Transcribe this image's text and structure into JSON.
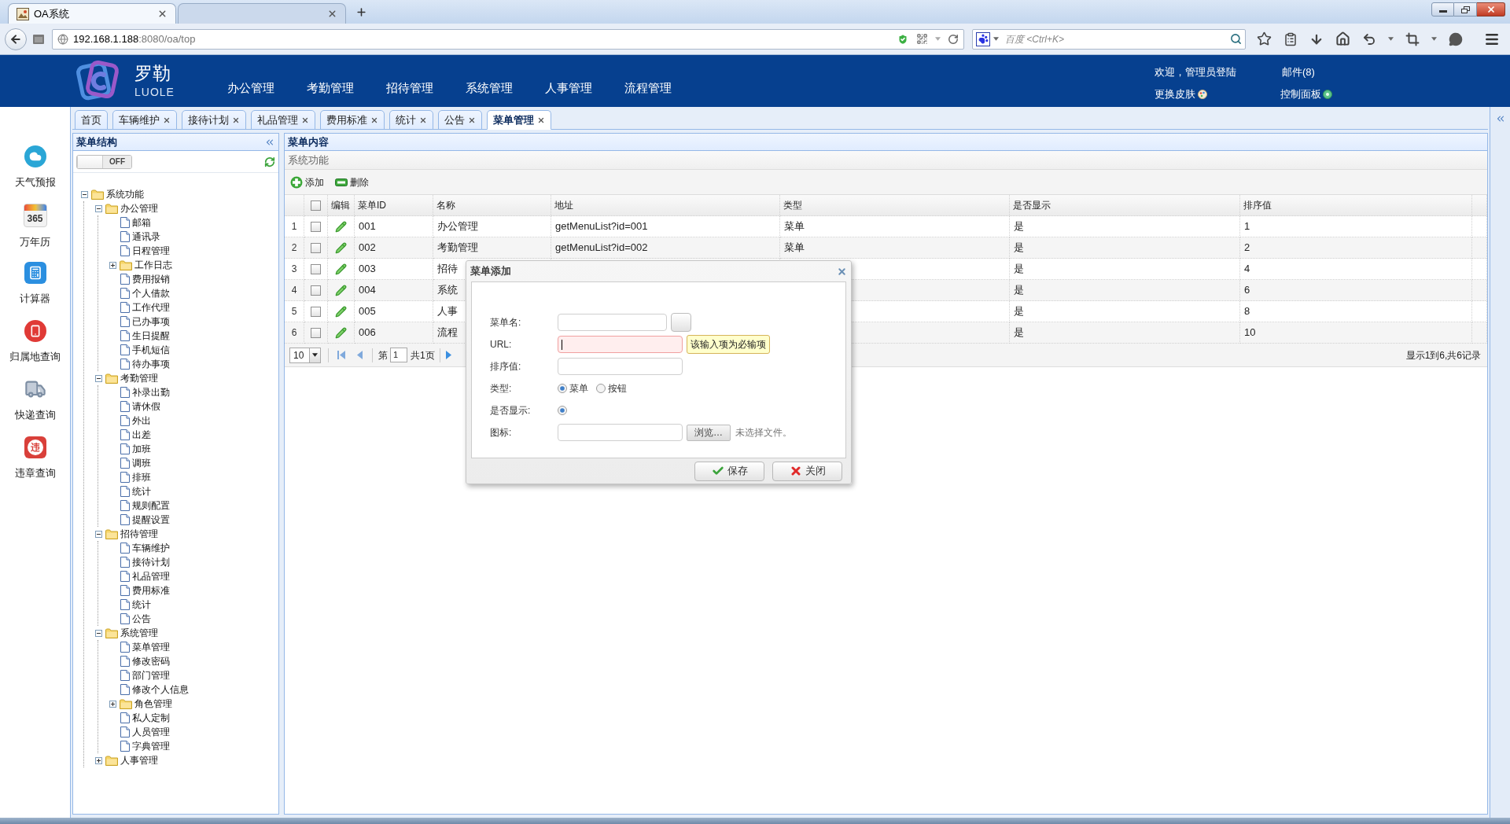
{
  "browser": {
    "tabs": [
      {
        "title": "OA系统",
        "selected": true
      },
      {
        "selected": false
      }
    ],
    "address": {
      "host": "192.168.1.188",
      "rest": ":8080/oa/top"
    },
    "search": {
      "placeholder": "百度 <Ctrl+K>"
    }
  },
  "header": {
    "logo": {
      "title": "罗勒",
      "subtitle": "LUOLE"
    },
    "nav": [
      "办公管理",
      "考勤管理",
      "招待管理",
      "系统管理",
      "人事管理",
      "流程管理"
    ],
    "user": {
      "welcome": "欢迎，管理员登陆",
      "mail": "邮件(8)",
      "skin": "更换皮肤",
      "control_panel": "控制面板"
    }
  },
  "tools": [
    {
      "kind": "weather",
      "label": "天气预报"
    },
    {
      "kind": "calendar",
      "label": "万年历",
      "icon_text": "365"
    },
    {
      "kind": "calculator",
      "label": "计算器"
    },
    {
      "kind": "phone",
      "label": "归属地查询"
    },
    {
      "kind": "delivery",
      "label": "快递查询"
    },
    {
      "kind": "violation",
      "label": "违章查询",
      "icon_text": "违"
    }
  ],
  "tabs": [
    {
      "label": "首页",
      "selected": false,
      "closable": false
    },
    {
      "label": "车辆维护",
      "selected": false,
      "closable": true
    },
    {
      "label": "接待计划",
      "selected": false,
      "closable": true
    },
    {
      "label": "礼品管理",
      "selected": false,
      "closable": true
    },
    {
      "label": "费用标准",
      "selected": false,
      "closable": true
    },
    {
      "label": "统计",
      "selected": false,
      "closable": true
    },
    {
      "label": "公告",
      "selected": false,
      "closable": true
    },
    {
      "label": "菜单管理",
      "selected": true,
      "closable": true
    }
  ],
  "menu_tree": {
    "title": "菜单结构",
    "toggle": {
      "label": "OFF",
      "on": false
    },
    "nodes": [
      {
        "label": "系统功能",
        "kind": "folder",
        "expanded": true,
        "children": [
          {
            "label": "办公管理",
            "kind": "folder",
            "expanded": true,
            "children": [
              {
                "label": "邮箱",
                "kind": "file"
              },
              {
                "label": "通讯录",
                "kind": "file"
              },
              {
                "label": "日程管理",
                "kind": "file"
              },
              {
                "label": "工作日志",
                "kind": "folder",
                "expanded": false
              },
              {
                "label": "费用报销",
                "kind": "file"
              },
              {
                "label": "个人借款",
                "kind": "file"
              },
              {
                "label": "工作代理",
                "kind": "file"
              },
              {
                "label": "已办事项",
                "kind": "file"
              },
              {
                "label": "生日提醒",
                "kind": "file"
              },
              {
                "label": "手机短信",
                "kind": "file"
              },
              {
                "label": "待办事项",
                "kind": "file"
              }
            ]
          },
          {
            "label": "考勤管理",
            "kind": "folder",
            "expanded": true,
            "children": [
              {
                "label": "补录出勤",
                "kind": "file"
              },
              {
                "label": "请休假",
                "kind": "file"
              },
              {
                "label": "外出",
                "kind": "file"
              },
              {
                "label": "出差",
                "kind": "file"
              },
              {
                "label": "加班",
                "kind": "file"
              },
              {
                "label": "调班",
                "kind": "file"
              },
              {
                "label": "排班",
                "kind": "file"
              },
              {
                "label": "统计",
                "kind": "file"
              },
              {
                "label": "规则配置",
                "kind": "file"
              },
              {
                "label": "提醒设置",
                "kind": "file"
              }
            ]
          },
          {
            "label": "招待管理",
            "kind": "folder",
            "expanded": true,
            "children": [
              {
                "label": "车辆维护",
                "kind": "file"
              },
              {
                "label": "接待计划",
                "kind": "file"
              },
              {
                "label": "礼品管理",
                "kind": "file"
              },
              {
                "label": "费用标准",
                "kind": "file"
              },
              {
                "label": "统计",
                "kind": "file"
              },
              {
                "label": "公告",
                "kind": "file"
              }
            ]
          },
          {
            "label": "系统管理",
            "kind": "folder",
            "expanded": true,
            "children": [
              {
                "label": "菜单管理",
                "kind": "file"
              },
              {
                "label": "修改密码",
                "kind": "file"
              },
              {
                "label": "部门管理",
                "kind": "file"
              },
              {
                "label": "修改个人信息",
                "kind": "file"
              },
              {
                "label": "角色管理",
                "kind": "folder",
                "expanded": false
              },
              {
                "label": "私人定制",
                "kind": "file"
              },
              {
                "label": "人员管理",
                "kind": "file"
              },
              {
                "label": "字典管理",
                "kind": "file"
              }
            ]
          },
          {
            "label": "人事管理",
            "kind": "folder",
            "expanded": false
          }
        ]
      }
    ]
  },
  "content": {
    "title": "菜单内容",
    "section": "系统功能",
    "toolbar": [
      {
        "kind": "add",
        "label": "添加"
      },
      {
        "kind": "remove",
        "label": "删除"
      }
    ],
    "table": {
      "header_checked": false,
      "columns": [
        "编辑",
        "菜单ID",
        "名称",
        "地址",
        "类型",
        "是否显示",
        "排序值"
      ],
      "rows": [
        {
          "number": "1",
          "checked": false,
          "id": "001",
          "name": "办公管理",
          "address": "getMenuList?id=001",
          "type": "菜单",
          "visible": "是",
          "sort": "1"
        },
        {
          "number": "2",
          "checked": false,
          "id": "002",
          "name": "考勤管理",
          "address": "getMenuList?id=002",
          "type": "菜单",
          "visible": "是",
          "sort": "2"
        },
        {
          "number": "3",
          "checked": false,
          "id": "003",
          "name": "招待",
          "visible": "是",
          "sort": "4"
        },
        {
          "number": "4",
          "checked": false,
          "id": "004",
          "name": "系统",
          "visible": "是",
          "sort": "6"
        },
        {
          "number": "5",
          "checked": false,
          "id": "005",
          "name": "人事",
          "visible": "是",
          "sort": "8"
        },
        {
          "number": "6",
          "checked": false,
          "id": "006",
          "name": "流程",
          "visible": "是",
          "sort": "10"
        }
      ]
    },
    "pagination": {
      "page_size": "10",
      "page_label": "第",
      "page": "1",
      "total": "共1页",
      "summary": "显示1到6,共6记录"
    }
  },
  "dialog": {
    "title": "菜单添加",
    "fields": [
      {
        "kind": "text",
        "label": "菜单名:",
        "side_button": true
      },
      {
        "kind": "text",
        "label": "URL:",
        "invalid": true,
        "focused": true,
        "tooltip": "该输入项为必输项"
      },
      {
        "kind": "text",
        "label": "排序值:"
      },
      {
        "kind": "radio",
        "label": "类型:",
        "options": [
          {
            "label": "菜单",
            "selected": true
          },
          {
            "label": "按钮",
            "selected": false
          }
        ]
      },
      {
        "kind": "radio",
        "label": "是否显示:",
        "options": [
          {
            "selected": true
          }
        ]
      },
      {
        "kind": "file",
        "label": "图标:",
        "browse": "浏览…",
        "status": "未选择文件。"
      }
    ],
    "buttons": [
      {
        "kind": "save",
        "label": "保存"
      },
      {
        "kind": "close",
        "label": "关闭"
      }
    ]
  }
}
